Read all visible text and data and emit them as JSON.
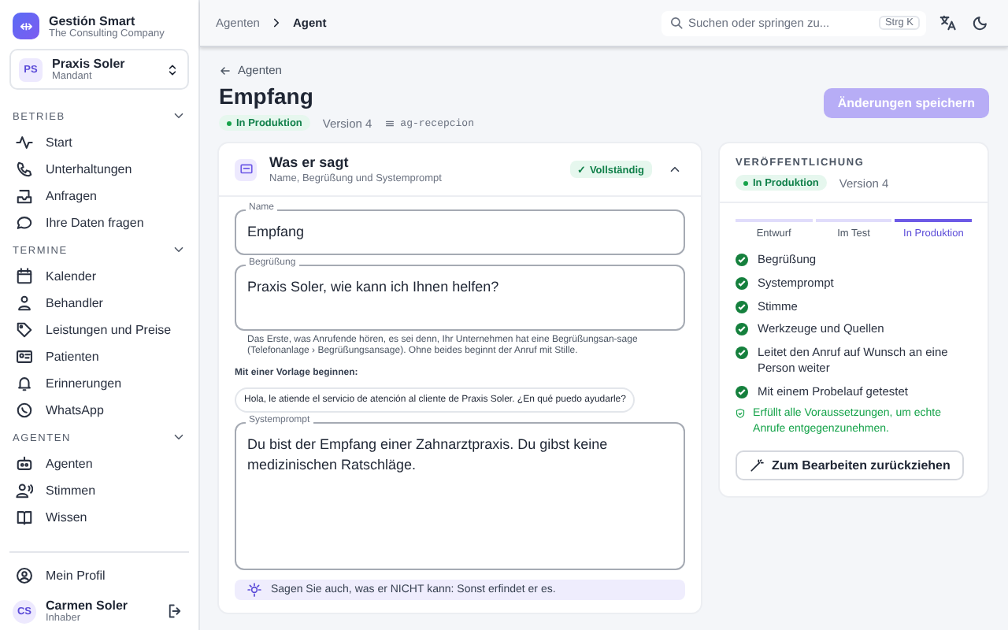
{
  "sidebar": {
    "app": {
      "title": "Gestión Smart",
      "subtitle": "The Consulting Company",
      "logo": "⇹"
    },
    "tenant": {
      "initials": "PS",
      "name": "Praxis Soler",
      "role": "Mandant"
    },
    "sections": [
      {
        "title": "BETRIEB",
        "expanded": true,
        "items": [
          {
            "label": "Start",
            "selected": false
          },
          {
            "label": "Unterhaltungen",
            "selected": false
          },
          {
            "label": "Anfragen",
            "selected": false
          },
          {
            "label": "Ihre Daten fragen",
            "selected": false
          }
        ]
      },
      {
        "title": "TERMINE",
        "expanded": true,
        "items": [
          {
            "label": "Kalender",
            "selected": false
          },
          {
            "label": "Behandler",
            "selected": false
          },
          {
            "label": "Leistungen und Preise",
            "selected": false
          },
          {
            "label": "Patienten",
            "selected": false
          },
          {
            "label": "Erinnerungen",
            "selected": false
          },
          {
            "label": "WhatsApp",
            "selected": false
          }
        ]
      },
      {
        "title": "AGENTEN",
        "expanded": true,
        "items": [
          {
            "label": "Agenten",
            "selected": false
          },
          {
            "label": "Stimmen",
            "selected": false
          },
          {
            "label": "Wissen",
            "selected": false
          }
        ]
      }
    ],
    "profile": "Mein Profil",
    "user": {
      "initials": "CS",
      "name": "Carmen Soler",
      "role": "Inhaber"
    }
  },
  "topbar": {
    "breadcrumbs": [
      {
        "label": "Agenten",
        "selected": false
      },
      {
        "label": "Agent",
        "selected": true
      }
    ],
    "search": {
      "placeholder": "Suchen oder springen zu...",
      "shortcut": "Strg K"
    }
  },
  "header": {
    "back": "Agenten",
    "title": "Empfang",
    "status": "In Produktion",
    "version": "Version 4",
    "id": "ag-recepcion",
    "save": "Änderungen speichern",
    "save_disabled": true
  },
  "section": {
    "title": "Was er sagt",
    "subtitle": "Name, Begrüßung und Systemprompt",
    "badge": "✓ Vollständig",
    "expanded": true,
    "name": {
      "label": "Name",
      "value": "Empfang"
    },
    "greeting": {
      "label": "Begrüßung",
      "value": "Praxis Soler, wie kann ich Ihnen helfen?",
      "help": "Das Erste, was Anrufende hören, es sei denn, Ihr Unternehmen hat eine Begrüßungsan-sage (Telefonanlage › Begrüßungsansage). Ohne beides beginnt der Anruf mit Stille."
    },
    "template_label": "Mit einer Vorlage beginnen:",
    "templates": [
      "Hola, le atiende el servicio de atención al cliente de Praxis Soler. ¿En qué puedo ayudarle?"
    ],
    "prompt": {
      "label": "Systemprompt",
      "value": "Du bist der Empfang einer Zahnarztpraxis. Du gibst keine medizinischen Ratschläge."
    },
    "tip": "Sagen Sie auch, was er NICHT kann: Sonst erfindet er es."
  },
  "publish": {
    "title": "VERÖFFENTLICHUNG",
    "status": "In Produktion",
    "version": "Version 4",
    "steps": [
      {
        "label": "Entwurf",
        "selected": false
      },
      {
        "label": "Im Test",
        "selected": false
      },
      {
        "label": "In Produktion",
        "selected": true
      }
    ],
    "checks": [
      {
        "label": "Begrüßung",
        "checked": true
      },
      {
        "label": "Systemprompt",
        "checked": true
      },
      {
        "label": "Stimme",
        "checked": true
      },
      {
        "label": "Werkzeuge und Quellen",
        "checked": true
      },
      {
        "label": "Leitet den Anruf auf Wunsch an eine Person weiter",
        "checked": true
      },
      {
        "label": "Mit einem Probelauf getestet",
        "checked": true
      }
    ],
    "ready": "Erfüllt alle Voraussetzungen, um echte Anrufe entgegenzunehmen.",
    "withdraw": "Zum Bearbeiten zurückziehen"
  }
}
